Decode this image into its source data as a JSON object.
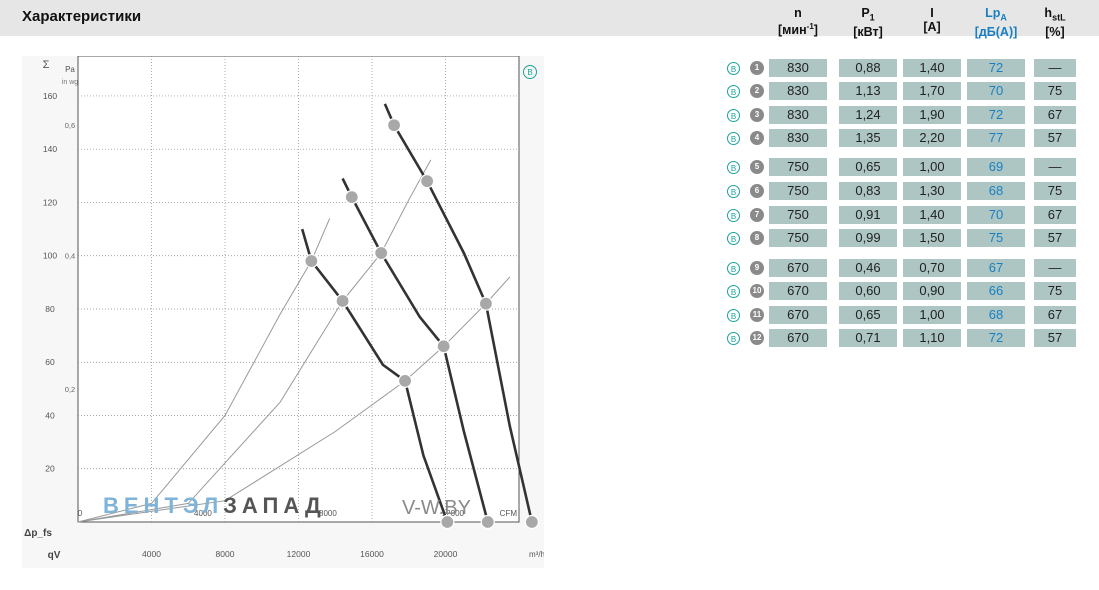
{
  "header": {
    "title": "Характеристики",
    "columns": [
      {
        "symbol": "n",
        "sub": "",
        "unit_pre": "[мин",
        "unit_sup": "-1",
        "unit_post": "]"
      },
      {
        "symbol": "P",
        "sub": "1",
        "unit_pre": "[кВт]",
        "unit_sup": "",
        "unit_post": ""
      },
      {
        "symbol": "I",
        "sub": "",
        "unit_pre": "[A]",
        "unit_sup": "",
        "unit_post": ""
      },
      {
        "symbol": "Lp",
        "sub": "A",
        "unit_pre": "[дБ(A)]",
        "unit_sup": "",
        "unit_post": ""
      },
      {
        "symbol": "h",
        "sub": "stL",
        "unit_pre": "[%]",
        "unit_sup": "",
        "unit_post": ""
      }
    ]
  },
  "table": {
    "mode_label": "B",
    "rows": [
      {
        "num": "1",
        "n": "830",
        "p1": "0,88",
        "i": "1,40",
        "lpa": "72",
        "h": "—"
      },
      {
        "num": "2",
        "n": "830",
        "p1": "1,13",
        "i": "1,70",
        "lpa": "70",
        "h": "75"
      },
      {
        "num": "3",
        "n": "830",
        "p1": "1,24",
        "i": "1,90",
        "lpa": "72",
        "h": "67"
      },
      {
        "num": "4",
        "n": "830",
        "p1": "1,35",
        "i": "2,20",
        "lpa": "77",
        "h": "57"
      },
      {
        "num": "5",
        "n": "750",
        "p1": "0,65",
        "i": "1,00",
        "lpa": "69",
        "h": "—"
      },
      {
        "num": "6",
        "n": "750",
        "p1": "0,83",
        "i": "1,30",
        "lpa": "68",
        "h": "75"
      },
      {
        "num": "7",
        "n": "750",
        "p1": "0,91",
        "i": "1,40",
        "lpa": "70",
        "h": "67"
      },
      {
        "num": "8",
        "n": "750",
        "p1": "0,99",
        "i": "1,50",
        "lpa": "75",
        "h": "57"
      },
      {
        "num": "9",
        "n": "670",
        "p1": "0,46",
        "i": "0,70",
        "lpa": "67",
        "h": "—"
      },
      {
        "num": "10",
        "n": "670",
        "p1": "0,60",
        "i": "0,90",
        "lpa": "66",
        "h": "75"
      },
      {
        "num": "11",
        "n": "670",
        "p1": "0,65",
        "i": "1,00",
        "lpa": "68",
        "h": "67"
      },
      {
        "num": "12",
        "n": "670",
        "p1": "0,71",
        "i": "1,10",
        "lpa": "72",
        "h": "57"
      }
    ]
  },
  "watermark": {
    "part1": "ВЕНТЭЛ",
    "part2": "ЗАПАД",
    "part3": "V-W.BY"
  },
  "colors": {
    "accent_blue": "#1a7fc1",
    "cell_bg": "#adc6c4",
    "curve": "#333333",
    "marker": "#a8a8a8",
    "teal": "#1aa39a"
  },
  "chart_data": {
    "type": "line",
    "title": "",
    "mode_badge": "B",
    "y_left": {
      "unit_top": "Pa",
      "ticks": [
        "20",
        "40",
        "60",
        "80",
        "100",
        "120",
        "140",
        "160"
      ],
      "lim": [
        0,
        175
      ]
    },
    "y_inner": {
      "unit_top": "in wg",
      "ticks": [
        "0,2",
        "0,4",
        "0,6"
      ]
    },
    "y_label": "Δp_fs",
    "x_top": {
      "unit": "CFM",
      "ticks": [
        "0",
        "4000",
        "8000",
        "12000"
      ]
    },
    "x_bottom": {
      "unit": "m³/h",
      "ticks": [
        "4000",
        "8000",
        "12000",
        "16000",
        "20000"
      ],
      "lim": [
        0,
        24000
      ]
    },
    "x_label": "qV",
    "series": [
      {
        "values": [
          [
            16700,
            157
          ],
          [
            17200,
            149
          ],
          [
            19000,
            128
          ],
          [
            21000,
            101
          ],
          [
            22200,
            82
          ],
          [
            23500,
            36
          ],
          [
            24700,
            0
          ]
        ]
      },
      {
        "values": [
          [
            14400,
            129
          ],
          [
            14900,
            122
          ],
          [
            16500,
            101
          ],
          [
            18600,
            77
          ],
          [
            19900,
            66
          ],
          [
            21000,
            34
          ],
          [
            22300,
            0
          ]
        ]
      },
      {
        "values": [
          [
            12200,
            110
          ],
          [
            12700,
            98
          ],
          [
            14400,
            83
          ],
          [
            16600,
            59
          ],
          [
            17800,
            53
          ],
          [
            18800,
            25
          ],
          [
            20100,
            0
          ]
        ]
      }
    ],
    "markers": [
      [
        17200,
        149
      ],
      [
        14900,
        122
      ],
      [
        12700,
        98
      ],
      [
        19000,
        128
      ],
      [
        16500,
        101
      ],
      [
        14400,
        83
      ],
      [
        22200,
        82
      ],
      [
        19900,
        66
      ],
      [
        17800,
        53
      ],
      [
        24700,
        0
      ],
      [
        22300,
        0
      ],
      [
        20100,
        0
      ]
    ],
    "system_curves": [
      {
        "points": [
          [
            0,
            0
          ],
          [
            4000,
            7
          ],
          [
            8000,
            40
          ],
          [
            11000,
            78
          ],
          [
            12700,
            98
          ],
          [
            13700,
            114
          ]
        ]
      },
      {
        "points": [
          [
            0,
            0
          ],
          [
            6000,
            7
          ],
          [
            11000,
            45
          ],
          [
            14400,
            83
          ],
          [
            16500,
            101
          ],
          [
            18000,
            121
          ],
          [
            19200,
            136
          ]
        ]
      },
      {
        "points": [
          [
            0,
            0
          ],
          [
            8000,
            8
          ],
          [
            14000,
            34
          ],
          [
            17800,
            53
          ],
          [
            19900,
            66
          ],
          [
            22200,
            82
          ],
          [
            23500,
            92
          ]
        ]
      }
    ]
  }
}
